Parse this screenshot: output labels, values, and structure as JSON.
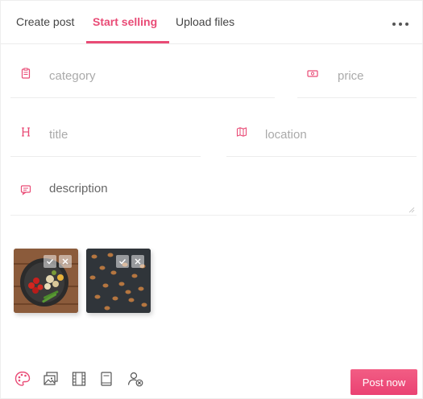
{
  "tabs": [
    {
      "label": "Create post"
    },
    {
      "label": "Start selling"
    },
    {
      "label": "Upload files"
    }
  ],
  "form": {
    "category_placeholder": "category",
    "price_placeholder": "price",
    "title_placeholder": "title",
    "location_placeholder": "location",
    "description_placeholder": "description"
  },
  "toolbar": {
    "post_label": "Post now"
  },
  "colors": {
    "accent": "#e94b76"
  }
}
